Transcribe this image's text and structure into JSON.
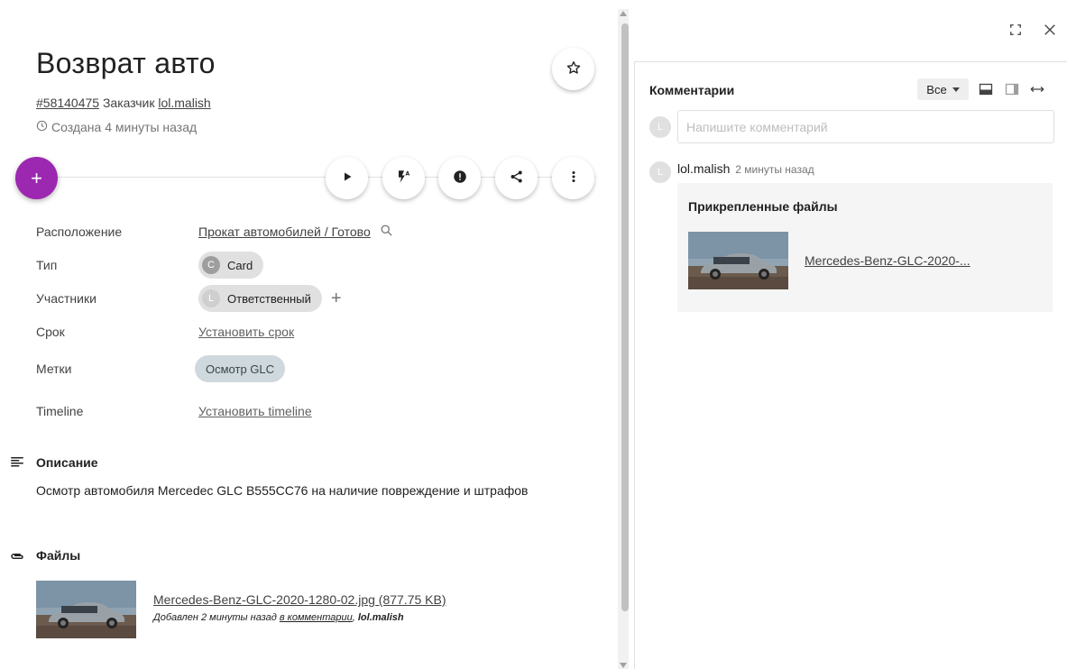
{
  "task": {
    "title": "Возврат авто",
    "id_link": "#58140475",
    "customer_label": "Заказчик",
    "customer": "lol.malish",
    "created": "Создана 4 минуты назад"
  },
  "actions": {
    "add_label": "+"
  },
  "properties": {
    "location": {
      "label": "Расположение",
      "value": "Прокат автомобилей / Готово"
    },
    "type": {
      "label": "Тип",
      "avatar": "C",
      "value": "Card"
    },
    "participants": {
      "label": "Участники",
      "avatar": "L",
      "value": "Ответственный",
      "add": "+"
    },
    "deadline": {
      "label": "Срок",
      "value": "Установить срок"
    },
    "tags": {
      "label": "Метки",
      "value": "Осмотр GLC"
    },
    "timeline": {
      "label": "Timeline",
      "value": "Установить timeline"
    }
  },
  "description": {
    "title": "Описание",
    "text": "Осмотр автомобиля Mercedec GLC В555СС76 на наличие повреждение и штрафов"
  },
  "files": {
    "title": "Файлы",
    "items": [
      {
        "name": "Mercedes-Benz-GLC-2020-1280-02.jpg (877.75 KB)",
        "meta_prefix": "Добавлен 2 минуты назад",
        "meta_link": "в комментарии",
        "meta_author": "lol.malish"
      }
    ]
  },
  "comments": {
    "title": "Комментарии",
    "filter": "Все",
    "input_placeholder": "Напишите комментарий",
    "current_avatar": "L",
    "items": [
      {
        "avatar": "L",
        "author": "lol.malish",
        "time": "2 минуты назад",
        "attachments_title": "Прикрепленные файлы",
        "attachment_name": "Mercedes-Benz-GLC-2020-..."
      }
    ]
  },
  "colors": {
    "fab": "#9c27b0",
    "tag_bg": "#cfd8dc",
    "chip_bg": "#e0e0e0"
  }
}
